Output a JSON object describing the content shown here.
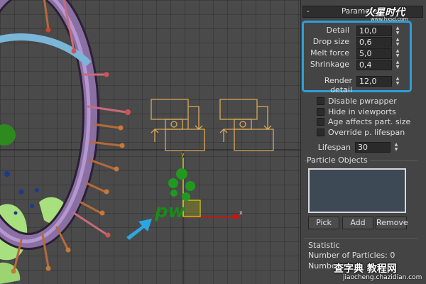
{
  "rollout": {
    "minus_label": "-",
    "title": "Parameters"
  },
  "params": [
    {
      "label": "Detail",
      "value": "10,0"
    },
    {
      "label": "Drop size",
      "value": "0,6"
    },
    {
      "label": "Melt force",
      "value": "5,0"
    },
    {
      "label": "Shrinkage",
      "value": "0,4"
    }
  ],
  "render_detail": {
    "label": "Render detail",
    "value": "12,0"
  },
  "checkboxes": [
    {
      "label": "Disable pwrapper",
      "checked": false
    },
    {
      "label": "Hide in viewports",
      "checked": false
    },
    {
      "label": "Age affects part. size",
      "checked": false
    },
    {
      "label": "Override p. lifespan",
      "checked": false
    }
  ],
  "lifespan": {
    "label": "Lifespan",
    "value": "30"
  },
  "particle_objects": {
    "title": "Particle Objects",
    "buttons": {
      "pick": "Pick",
      "add": "Add",
      "remove": "Remove"
    }
  },
  "statistic": {
    "title": "Statistic",
    "particles_line": "Number of Particles: 0",
    "second_line": "Number"
  },
  "viewport": {
    "gizmo_text": "pw",
    "axis_x": "x",
    "axis_y": "y"
  },
  "watermarks": {
    "top_logo": "火星时代",
    "top_url": "www.hxsd.com",
    "bottom_logo": "查字典 教程网",
    "bottom_url": "jiaocheng.chazidian.com"
  },
  "colors": {
    "highlight": "#2f9ed8",
    "helper_icon": "#d9a85a",
    "gizmo_green": "#1a8a1a",
    "arrow_blue": "#2aa7e2"
  }
}
